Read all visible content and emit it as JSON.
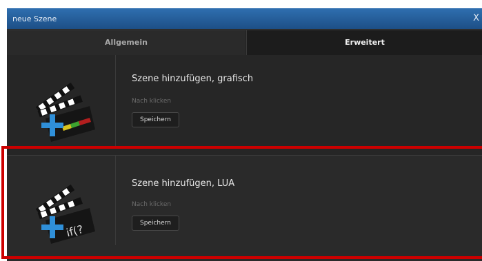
{
  "window": {
    "title": "neue Szene",
    "close_label": "X"
  },
  "tabs": [
    {
      "label": "Allgemein",
      "active": false
    },
    {
      "label": "Erweitert",
      "active": true
    }
  ],
  "rows": [
    {
      "title": "Szene hinzufügen, grafisch",
      "hint": "Nach klicken",
      "button": "Speichern",
      "icon": "clapperboard-add-graphic-icon"
    },
    {
      "title": "Szene hinzufügen, LUA",
      "hint": "Nach klicken",
      "button": "Speichern",
      "icon": "clapperboard-add-lua-icon",
      "icon_text": "if(?"
    }
  ],
  "colors": {
    "titlebar": "#2f6fb0",
    "highlight": "#cc0000",
    "plus": "#2f8fd8"
  }
}
